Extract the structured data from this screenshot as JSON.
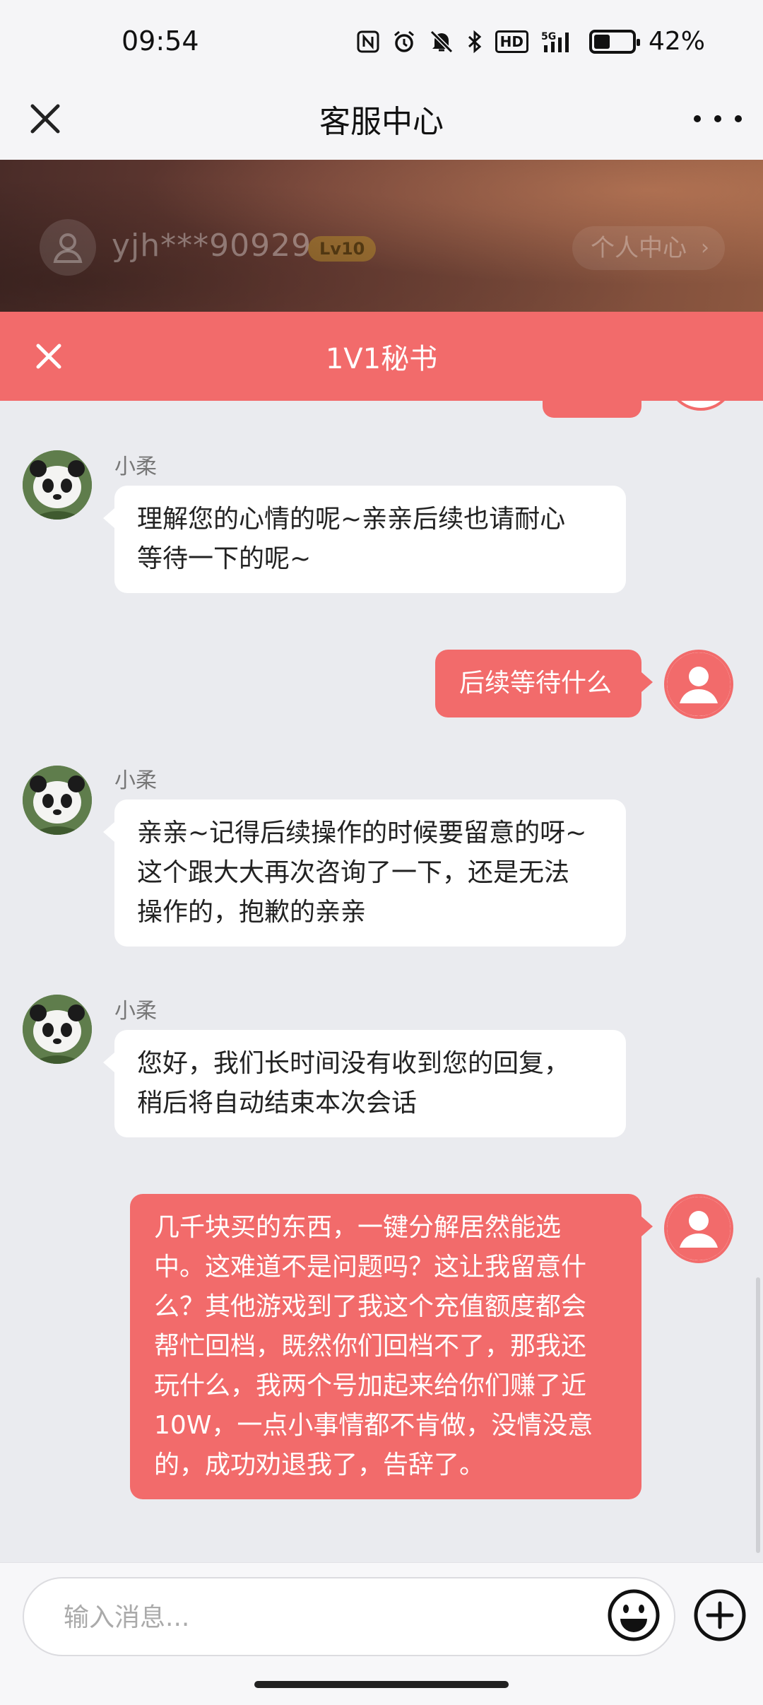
{
  "status_bar": {
    "time": "09:54",
    "battery_text": "42%",
    "battery_level": 0.42,
    "icons": [
      "nfc-icon",
      "alarm-icon",
      "mute-icon",
      "bluetooth-icon",
      "hd-icon",
      "5g-signal-icon",
      "battery-icon"
    ],
    "hd_label": "HD",
    "network_label": "5G"
  },
  "nav": {
    "title": "客服中心",
    "close_icon": "close-icon",
    "more_icon": "more-icon"
  },
  "profile": {
    "username": "yjh***90929",
    "level": "Lv10",
    "center_label": "个人中心",
    "chevron": "›"
  },
  "secretary": {
    "title": "1V1秘书"
  },
  "messages": [
    {
      "direction": "in",
      "sender": "小柔",
      "lines": [
        "理解您的心情的呢~亲亲后续也请耐心",
        "等待一下的呢~"
      ]
    },
    {
      "direction": "out",
      "lines": [
        "后续等待什么"
      ]
    },
    {
      "direction": "in",
      "sender": "小柔",
      "lines": [
        "亲亲~记得后续操作的时候要留意的呀~",
        "这个跟大大再次咨询了一下，还是无法",
        "操作的，抱歉的亲亲"
      ]
    },
    {
      "direction": "in",
      "sender": "小柔",
      "lines": [
        "您好，我们长时间没有收到您的回复，",
        "稍后将自动结束本次会话"
      ]
    },
    {
      "direction": "out",
      "lines": [
        "几千块买的东西，一键分解居然能选",
        "中。这难道不是问题吗？这让我留意什",
        "么？其他游戏到了我这个充值额度都会",
        "帮忙回档，既然你们回档不了，那我还",
        "玩什么，我两个号加起来给你们赚了近",
        "10W，一点小事情都不肯做，没情没意",
        "的，成功劝退我了，告辞了。"
      ]
    }
  ],
  "input": {
    "placeholder": "输入消息..."
  },
  "colors": {
    "accent": "#f26b6b",
    "background": "#eaebef",
    "bubble_in": "#ffffff"
  }
}
